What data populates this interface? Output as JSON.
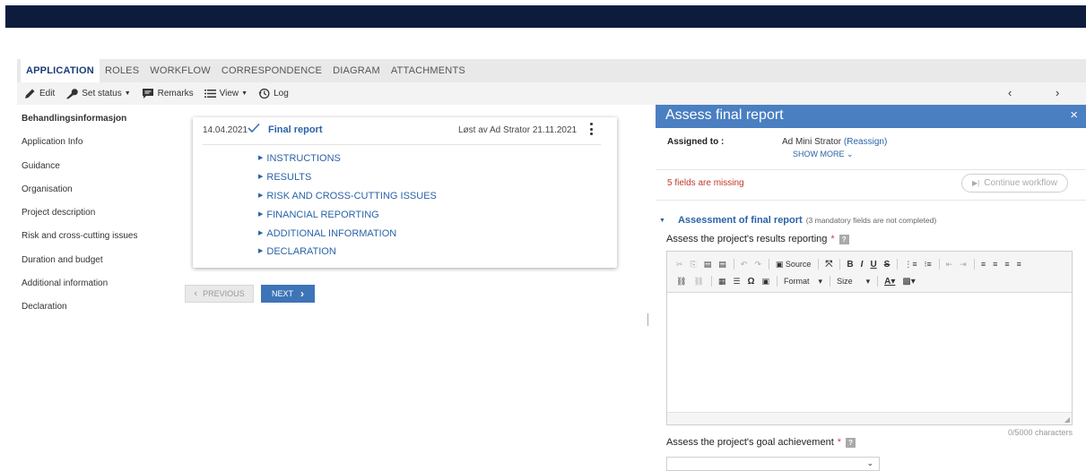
{
  "tabs": [
    "APPLICATION",
    "ROLES",
    "WORKFLOW",
    "CORRESPONDENCE",
    "DIAGRAM",
    "ATTACHMENTS"
  ],
  "toolbar": {
    "edit": "Edit",
    "set_status": "Set status",
    "remarks": "Remarks",
    "view": "View",
    "log": "Log",
    "prev_arrow": "‹",
    "next_arrow": "›"
  },
  "leftnav": [
    "Behandlingsinformasjon",
    "Application Info",
    "Guidance",
    "Organisation",
    "Project description",
    "Risk and cross-cutting issues",
    "Duration and budget",
    "Additional information",
    "Declaration"
  ],
  "card": {
    "date": "14.04.2021",
    "title": "Final report",
    "meta": "Løst av Ad Strator  21.11.2021",
    "sections": [
      "INSTRUCTIONS",
      "RESULTS",
      "RISK AND CROSS-CUTTING ISSUES",
      "FINANCIAL REPORTING",
      "ADDITIONAL INFORMATION",
      "DECLARATION"
    ]
  },
  "nav_buttons": {
    "previous": "PREVIOUS",
    "next": "NEXT"
  },
  "panel": {
    "title": "Assess final report",
    "close": "×",
    "assigned_label": "Assigned to :",
    "assigned_name": "Ad Mini Strator",
    "reassign": "(Reassign)",
    "show_more": "SHOW MORE",
    "missing": "5 fields are missing",
    "continue": "Continue workflow",
    "section_title": "Assessment of final report",
    "section_note": "(3 mandatory fields are not completed)",
    "q1": "Assess the project's results reporting",
    "q2": "Assess the project's goal achievement",
    "star": "*",
    "help": "?",
    "char_count": "0/5000 characters"
  },
  "editor": {
    "source": "Source",
    "format": "Format",
    "size": "Size"
  },
  "colors": {
    "header": "#0d1b3d",
    "accent": "#4a7fc1",
    "link": "#2a63a8",
    "error": "#c0392b"
  }
}
